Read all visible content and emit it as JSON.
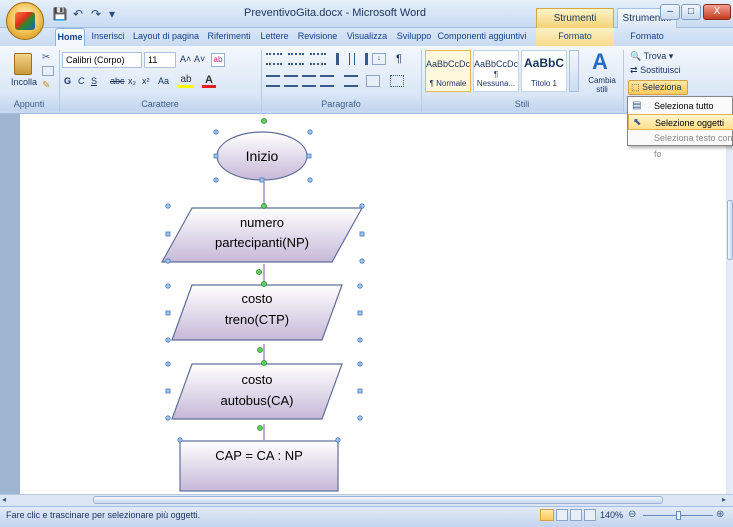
{
  "window": {
    "title": "PreventivoGita.docx - Microsoft Word",
    "context_tab_groups": [
      "Strumenti disegno",
      "Strument..."
    ],
    "controls": {
      "minimize": "–",
      "maximize": "□",
      "close": "X"
    }
  },
  "qat": {
    "save_icon": "💾",
    "undo_icon": "↶",
    "redo_icon": "↷",
    "customize_icon": "▾"
  },
  "tabs": [
    "Home",
    "Inserisci",
    "Layout di pagina",
    "Riferimenti",
    "Lettere",
    "Revisione",
    "Visualizza",
    "Sviluppo",
    "Componenti aggiuntivi",
    "Formato",
    "Formato"
  ],
  "ribbon": {
    "clipboard": {
      "paste_label": "Incolla",
      "group": "Appunti"
    },
    "font": {
      "font_name": "Calibri (Corpo)",
      "font_size": "11",
      "group": "Carattere",
      "bold": "G",
      "italic": "C",
      "underline": "S",
      "strike": "abc",
      "subscript": "x₂",
      "superscript": "x²",
      "case": "Aa",
      "grow": "A˄",
      "shrink": "A˅"
    },
    "paragraph": {
      "group": "Paragrafo"
    },
    "styles": {
      "group": "Stili",
      "tiles": [
        {
          "preview": "AaBbCcDc",
          "name": "¶ Normale"
        },
        {
          "preview": "AaBbCcDc",
          "name": "¶ Nessuna..."
        },
        {
          "preview": "AaBbC",
          "name": "Titolo 1"
        }
      ],
      "change_label": "Cambia stili"
    },
    "editing": {
      "find": "Trova",
      "replace": "Sostituisci",
      "select": "Seleziona"
    }
  },
  "menu": {
    "items": [
      {
        "label": "Seleziona tutto",
        "state": "normal"
      },
      {
        "label": "Selezione oggetti",
        "state": "highlighted"
      },
      {
        "label": "Seleziona testo con fo",
        "state": "disabled"
      }
    ]
  },
  "flowchart": {
    "nodes": [
      {
        "shape": "terminator",
        "lines": [
          "Inizio"
        ]
      },
      {
        "shape": "parallelogram",
        "lines": [
          "numero",
          "partecipanti(NP)"
        ]
      },
      {
        "shape": "parallelogram",
        "lines": [
          "costo",
          "treno(CTP)"
        ]
      },
      {
        "shape": "parallelogram",
        "lines": [
          "costo",
          "autobus(CA)"
        ]
      },
      {
        "shape": "process",
        "lines": [
          "CAP = CA : NP"
        ]
      }
    ],
    "fill_top": "#ffffff",
    "fill_bottom": "#c6b8d8",
    "stroke": "#5f6f9a",
    "connector_color": "#a08fc8"
  },
  "status": {
    "text": "Fare clic e trascinare per selezionare più oggetti.",
    "zoom": "140%"
  }
}
